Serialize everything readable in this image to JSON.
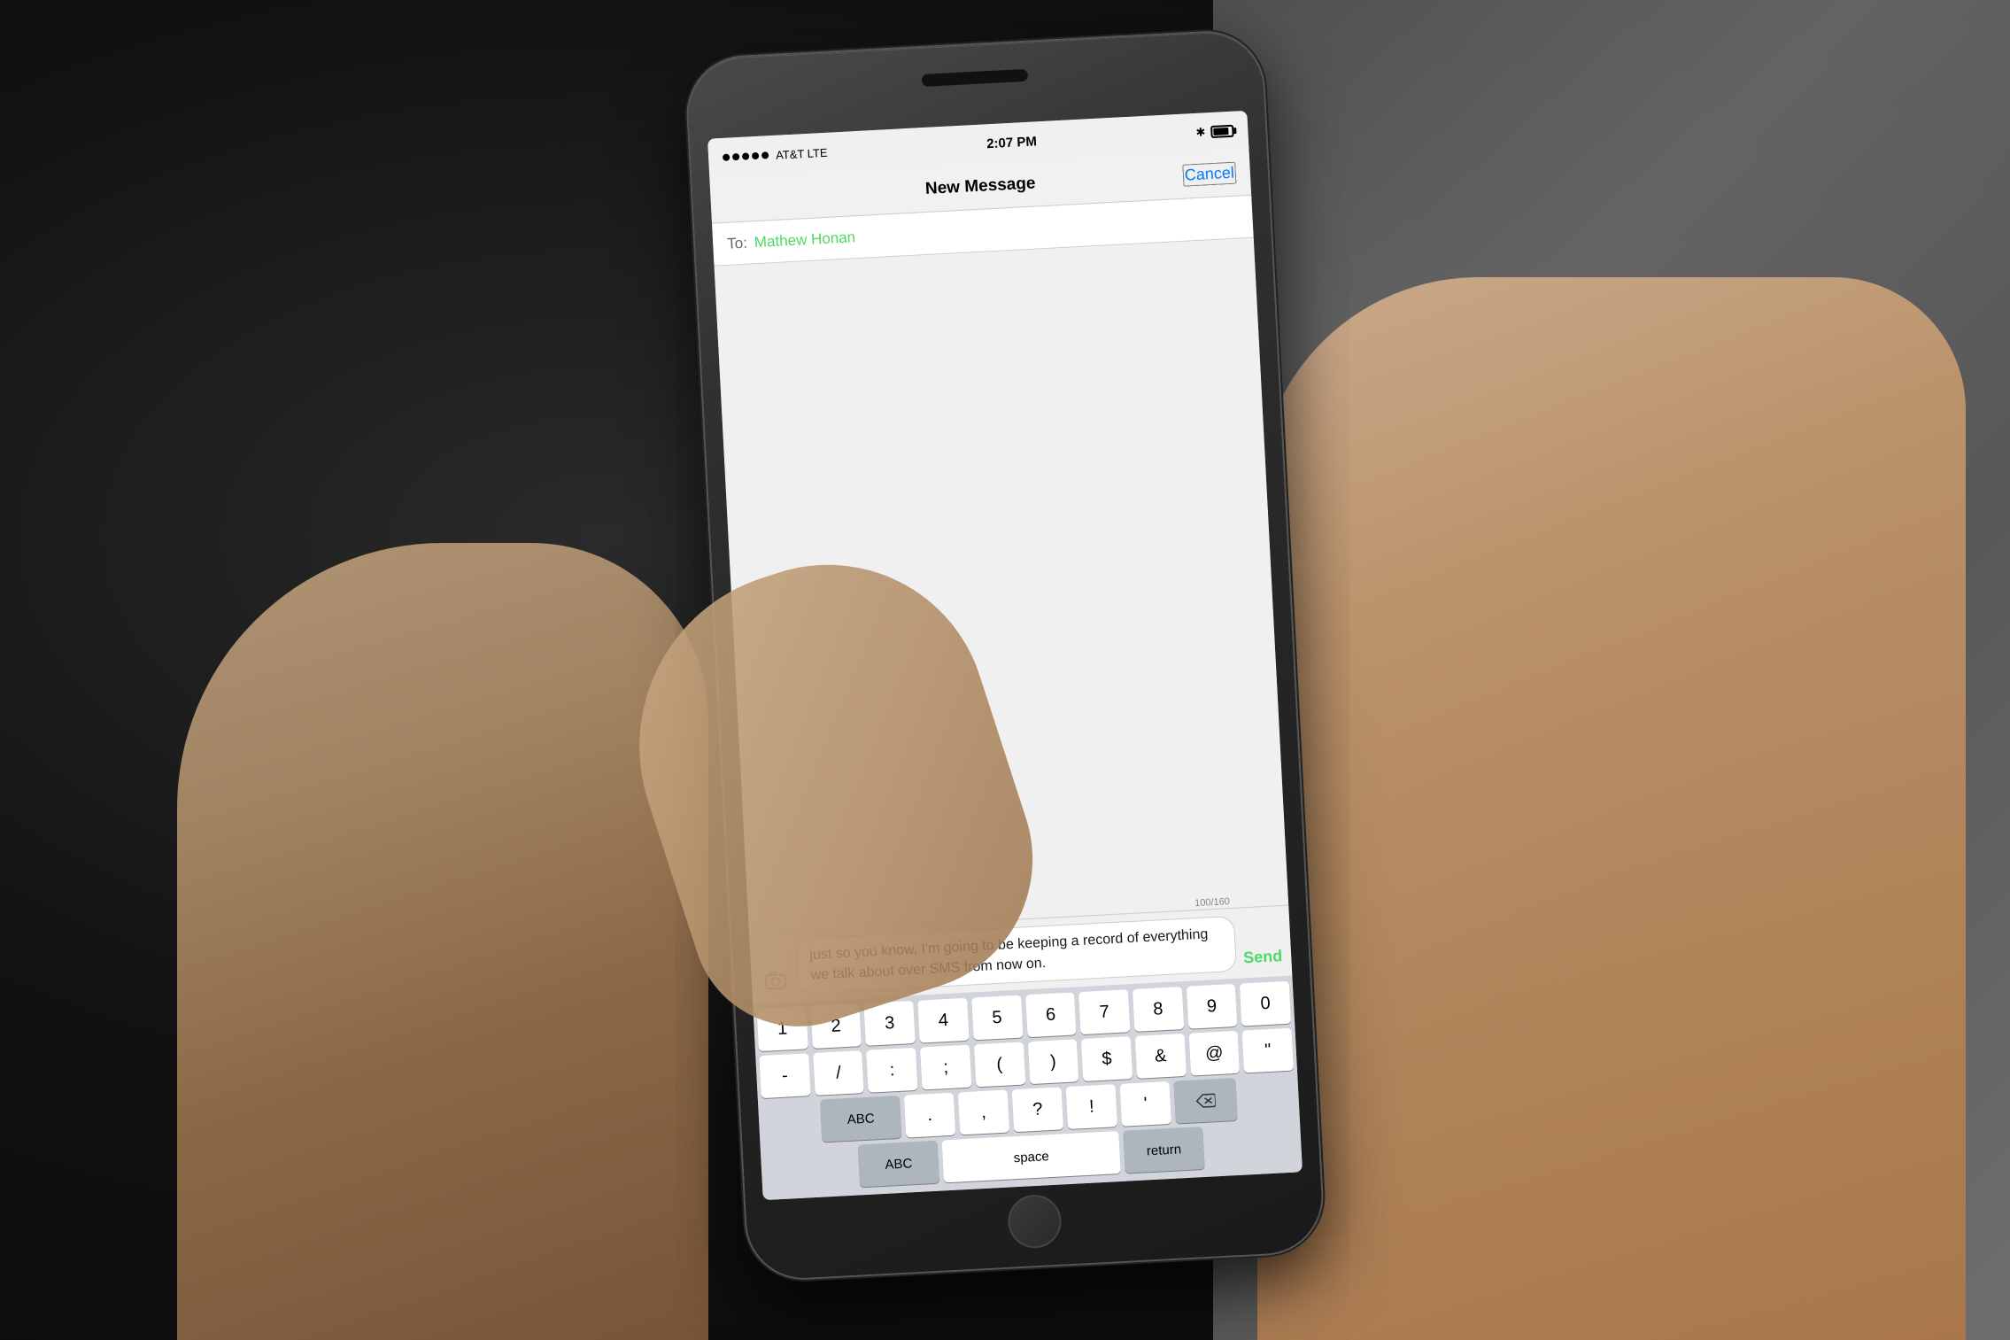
{
  "background": {
    "color": "#1a1a1a"
  },
  "status_bar": {
    "carrier": "AT&T LTE",
    "time": "2:07 PM",
    "bluetooth": "✱",
    "battery_level": 85
  },
  "nav": {
    "title": "New Message",
    "cancel_label": "Cancel"
  },
  "to_field": {
    "label": "To:",
    "recipient": "Mathew Honan"
  },
  "message": {
    "text": "just so you know, I'm going to be keeping a record of everything we talk about over SMS from now on.",
    "char_count": "100/160"
  },
  "send_button": {
    "label": "Send"
  },
  "keyboard": {
    "row1": [
      "1",
      "2",
      "3",
      "4",
      "5",
      "6",
      "7",
      "8",
      "9",
      "0"
    ],
    "row2": [
      "-",
      "/",
      ":",
      ";",
      "(",
      ")",
      "$",
      "&",
      "@",
      "\""
    ],
    "row3_left": [
      "ABC"
    ],
    "row3_special": [
      ".",
      ",",
      "?",
      "!",
      "'"
    ],
    "row3_right": [
      "⌫"
    ],
    "bottom_left": [
      "ABC"
    ],
    "bottom_space": "space",
    "bottom_return": "return"
  }
}
